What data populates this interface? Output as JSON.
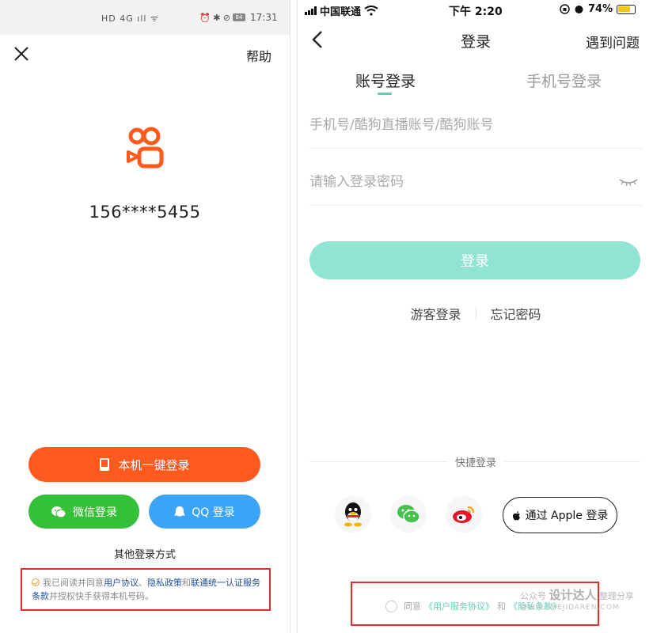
{
  "left": {
    "status": {
      "icons_left": "HD 4G ıll ᯤ",
      "icons_right": "⏰ ✱ ⊘",
      "battery": "84",
      "time": "17:31"
    },
    "header": {
      "help": "帮助"
    },
    "phone_number": "156****5455",
    "one_key_login": "本机一键登录",
    "wechat_login": "微信登录",
    "qq_login": "QQ 登录",
    "other_login": "其他登录方式",
    "agreement": {
      "prefix": "我已阅读并同意",
      "user_agreement": "用户协议",
      "sep1": "、",
      "privacy_policy": "隐私政策",
      "and": "和",
      "unicom_terms": "联通统一认证服务条款",
      "suffix": "并授权快手获得本机号码。"
    },
    "colors": {
      "brand": "#fe5a1e",
      "wechat": "#35c03a",
      "qq": "#3ba4f6",
      "link": "#1f4e9c"
    }
  },
  "right": {
    "status": {
      "carrier": "中国联通",
      "time": "下午 2:20",
      "battery_pct": "74%"
    },
    "header": {
      "title": "登录",
      "help": "遇到问题"
    },
    "tabs": {
      "account": "账号登录",
      "phone": "手机号登录"
    },
    "account_input": {
      "placeholder": "手机号/酷狗直播账号/酷狗账号",
      "value": ""
    },
    "password_input": {
      "placeholder": "请输入登录密码",
      "value": ""
    },
    "login_button": "登录",
    "guest_login": "游客登录",
    "forgot_password": "忘记密码",
    "quick_login": "快捷登录",
    "apple_login": "通过 Apple 登录",
    "agreement": {
      "agree": "同意",
      "user_service": "《用户服务协议》",
      "and": "和",
      "privacy": "《隐私条款》"
    },
    "watermark": {
      "prefix": "公众号",
      "brand": "设计达人",
      "suffix": "整理分享",
      "url": "WWW.SHEJIDAREN.COM"
    },
    "colors": {
      "accent": "#8fe4d2",
      "tab_indicator": "#5fd0b8"
    }
  }
}
